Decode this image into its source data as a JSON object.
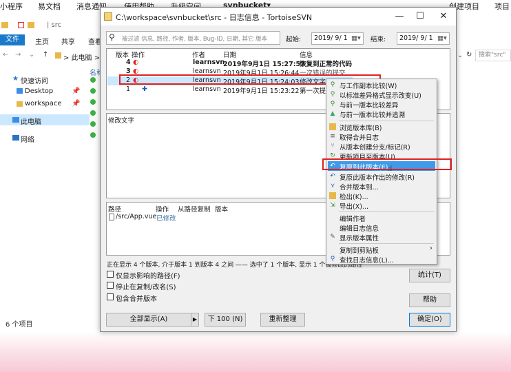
{
  "topbar": {
    "items": [
      "小程序",
      "易文档",
      "消息通知",
      "使用帮助",
      "升级空间",
      "svnbucket▾",
      "创建项目",
      "项目"
    ]
  },
  "explorer": {
    "path_hint": "| src",
    "ribbon_tabs": [
      "文件",
      "主页",
      "共享",
      "查看"
    ],
    "address": "> 此电脑 >",
    "column_header": "名称",
    "quick_access": "快速访问",
    "desktop": "Desktop",
    "workspace": "workspace",
    "this_pc": "此电脑",
    "network": "网络",
    "item_count": "6 个项目",
    "search_placeholder": "搜索\"src\""
  },
  "dialog": {
    "title": "C:\\workspace\\svnbucket\\src - 日志信息 - TortoiseSVN",
    "filter_placeholder": "被过滤 信息, 路径, 作者, 版本, Bug-ID, 日期, 其它 版本",
    "from_label": "起始:",
    "from_date": "2019/ 9/ 1",
    "to_label": "结束:",
    "to_date": "2019/ 9/ 1",
    "columns": [
      "版本",
      "操作",
      "作者",
      "日期",
      "信息"
    ],
    "revisions": [
      {
        "rev": "4",
        "author": "learnsvn",
        "date": "2019年9月1日 15:27:57",
        "msg": "恢复到正常的代码",
        "bold": true
      },
      {
        "rev": "3",
        "author": "learnsvn",
        "date": "2019年9月1日 15:26:44",
        "msg": "一次错误的提交",
        "bold": false
      },
      {
        "rev": "2",
        "author": "learnsvn",
        "date": "2019年9月1日 15:24:03",
        "msg": "修改文字",
        "bold": false
      },
      {
        "rev": "1",
        "author": "learnsvn",
        "date": "2019年9月1日 15:23:22",
        "msg": "第一次提交",
        "bold": false
      }
    ],
    "message_text": "修改文字",
    "path_columns": [
      "路径",
      "操作",
      "从路径复制",
      "版本"
    ],
    "changed_path": "/src/App.vue",
    "changed_action": "已修改",
    "status_text": "正在显示 4 个版本, 介于版本 1 到版本 4 之间 —— 选中了 1 个版本, 显示 1 个被修改的路径",
    "checkboxes": [
      "仅显示影响的路径(F)",
      "停止在复制/改名(S)",
      "包含合并版本"
    ],
    "buttons": {
      "stats": "统计(T)",
      "help": "帮助",
      "show_all": "全部显示(A)",
      "next100": "下 100 (N)",
      "refresh": "重新整理",
      "ok": "确定(O)"
    }
  },
  "context_menu": {
    "items": [
      {
        "label": "与工作副本比较(W)",
        "icon": "compare-icon"
      },
      {
        "label": "以标准差异格式显示改变(U)",
        "icon": "diff-icon"
      },
      {
        "label": "与前一版本比较差异",
        "icon": "compare-prev-icon"
      },
      {
        "label": "与前一版本比较并追溯",
        "icon": "blame-icon"
      },
      {
        "label": "浏览版本库(B)",
        "icon": "repo-browser-icon"
      },
      {
        "label": "取得合并日志",
        "icon": "merge-log-icon"
      },
      {
        "label": "从版本创建分支/标记(R)",
        "icon": "branch-icon"
      },
      {
        "label": "更新项目至版本(U)",
        "icon": "update-icon"
      },
      {
        "label": "复原到此版本(E)",
        "icon": "revert-icon"
      },
      {
        "label": "复原此版本作出的修改(R)",
        "icon": "revert-changes-icon"
      },
      {
        "label": "合并版本到...",
        "icon": "merge-icon"
      },
      {
        "label": "检出(K)...",
        "icon": "checkout-icon"
      },
      {
        "label": "导出(X)...",
        "icon": "export-icon"
      },
      {
        "label": "编辑作者",
        "icon": ""
      },
      {
        "label": "编辑日志信息",
        "icon": ""
      },
      {
        "label": "显示版本属性",
        "icon": "properties-icon"
      },
      {
        "label": "复制到剪贴板",
        "icon": "",
        "submenu": "›"
      },
      {
        "label": "查找日志信息(L)...",
        "icon": "search-icon"
      }
    ]
  },
  "colors": {
    "accent": "#3d9be9",
    "selection": "#cce8ff",
    "highlight_box": "#e02020",
    "file_tab": "#1979ca"
  }
}
